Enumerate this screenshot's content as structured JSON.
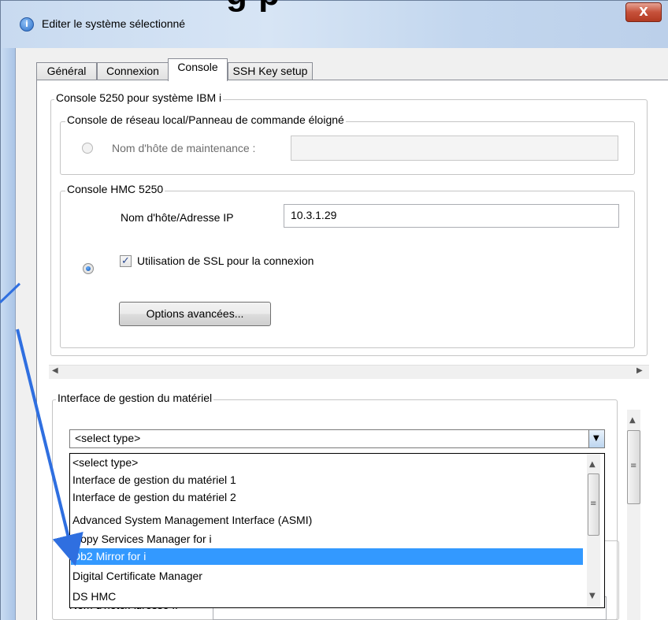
{
  "window": {
    "heading_fragment": "g     p",
    "title": "Editer le système sélectionné",
    "close_glyph": "X"
  },
  "tabs": [
    {
      "label": "Général",
      "active": false
    },
    {
      "label": "Connexion",
      "active": false
    },
    {
      "label": "Console",
      "active": true
    },
    {
      "label": "SSH Key setup",
      "active": false
    }
  ],
  "console_group": {
    "legend": "Console 5250 pour système IBM i",
    "lan_group": {
      "legend": "Console de réseau local/Panneau de commande éloigné",
      "hostname_label": "Nom d'hôte de maintenance :",
      "hostname_value": ""
    },
    "hmc_group": {
      "legend": "Console HMC 5250",
      "host_label": "Nom d'hôte/Adresse IP",
      "host_value": "10.3.1.29",
      "ssl_label": "Utilisation de SSL pour la connexion",
      "ssl_checked": true,
      "advanced_button": "Options avancées..."
    }
  },
  "hardware_group": {
    "legend": "Interface de gestion du matériel",
    "combo_value": "<select type>",
    "options": [
      "<select type>",
      "Interface de gestion du matériel 1",
      "Interface de gestion du matériel 2",
      "Advanced System Management Interface (ASMI)",
      "Copy Services Manager for i",
      "Db2 Mirror for i",
      "Digital Certificate Manager",
      "DS HMC"
    ],
    "selected_option": "Db2 Mirror for i",
    "bottom_label": "Nom d'hôte/Adresse IP"
  },
  "icons": {
    "title_icon": "i",
    "check_glyph": "✓",
    "arrow_left": "◀",
    "arrow_right": "▶",
    "arrow_up": "▲",
    "arrow_down": "▼",
    "grip": "≡"
  },
  "colors": {
    "selection": "#3399ff",
    "annotation_arrow": "#2f6fe0"
  }
}
